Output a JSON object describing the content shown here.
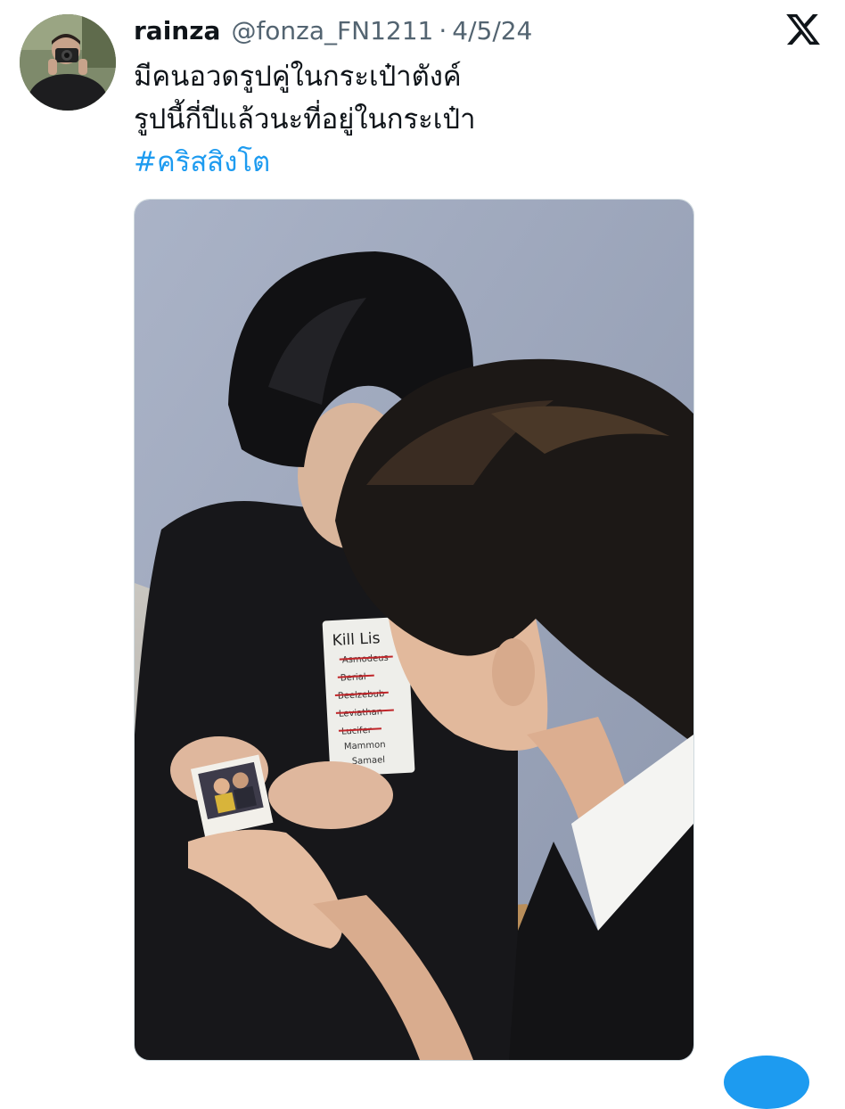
{
  "tweet": {
    "display_name": "rainza",
    "handle": "@fonza_FN1211",
    "separator": "·",
    "date": "4/5/24",
    "text_lines": [
      "มีคนอวดรูปคู่ในกระเป๋าตังค์",
      "รูปนี้กี่ปีแล้วนะที่อยู่ในกระเป๋า"
    ],
    "hashtag": "#คริสสิงโต"
  },
  "media": {
    "shirt_print": {
      "title": "Kill Lis",
      "names": [
        "Asmodeus",
        "Berial",
        "Beelzebub",
        "Leviathan",
        "Lucifer",
        "Mammon",
        "Samael"
      ]
    }
  },
  "colors": {
    "link": "#1d9bf0",
    "secondary_text": "#536471",
    "primary_text": "#0f1419",
    "wall": "#a9b2c6"
  },
  "icons": {
    "brand": "x-logo-icon",
    "avatar": "avatar-photographer"
  }
}
